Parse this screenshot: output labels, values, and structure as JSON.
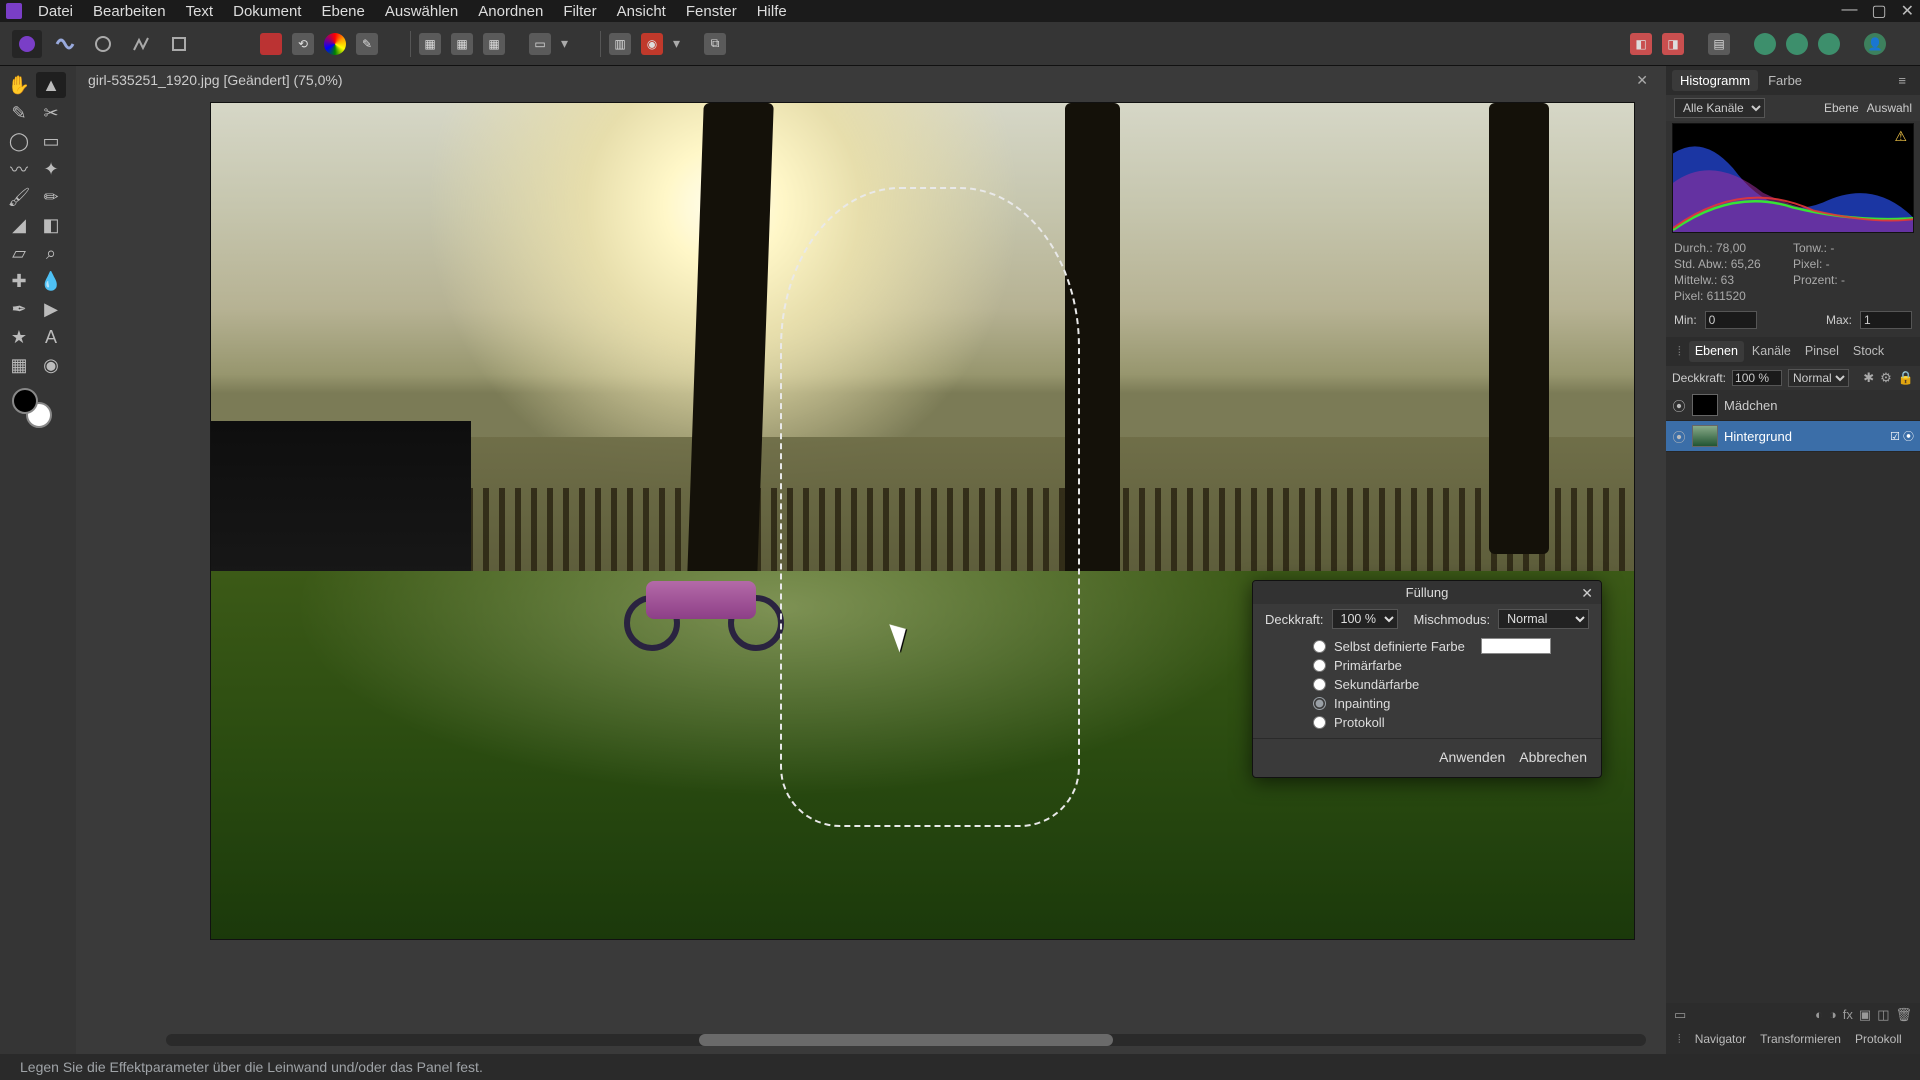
{
  "menu": [
    "Datei",
    "Bearbeiten",
    "Text",
    "Dokument",
    "Ebene",
    "Auswählen",
    "Anordnen",
    "Filter",
    "Ansicht",
    "Fenster",
    "Hilfe"
  ],
  "document": {
    "tab_label": "girl-535251_1920.jpg [Geändert] (75,0%)"
  },
  "status": {
    "hint": "Legen Sie die Effektparameter über die Leinwand und/oder das Panel fest."
  },
  "histogram_panel": {
    "tabs": [
      "Histogramm",
      "Farbe"
    ],
    "channel_label": "Alle Kanäle",
    "scope": [
      "Ebene",
      "Auswahl"
    ],
    "stats": {
      "durch": "Durch.: 78,00",
      "stdabw": "Std. Abw.: 65,26",
      "mittelw": "Mittelw.: 63",
      "pixel": "Pixel: 611520",
      "tonw": "Tonw.: -",
      "pixelr": "Pixel: -",
      "prozent": "Prozent: -"
    },
    "min_label": "Min:",
    "min_value": "0",
    "max_label": "Max:",
    "max_value": "1"
  },
  "layers_panel": {
    "tabs": [
      "Ebenen",
      "Kanäle",
      "Pinsel",
      "Stock"
    ],
    "opacity_label": "Deckkraft:",
    "opacity_value": "100 %",
    "blend_value": "Normal",
    "layers": [
      {
        "name": "Mädchen",
        "selected": false
      },
      {
        "name": "Hintergrund",
        "selected": true
      }
    ]
  },
  "bottom_tabs": [
    "Navigator",
    "Transformieren",
    "Protokoll"
  ],
  "fill_dialog": {
    "title": "Füllung",
    "opacity_label": "Deckkraft:",
    "opacity_value": "100 %",
    "blend_label": "Mischmodus:",
    "blend_value": "Normal",
    "options": [
      {
        "label": "Selbst definierte Farbe",
        "checked": false,
        "swatch": true
      },
      {
        "label": "Primärfarbe",
        "checked": false
      },
      {
        "label": "Sekundärfarbe",
        "checked": false
      },
      {
        "label": "Inpainting",
        "checked": true
      },
      {
        "label": "Protokoll",
        "checked": false
      }
    ],
    "apply": "Anwenden",
    "cancel": "Abbrechen"
  }
}
